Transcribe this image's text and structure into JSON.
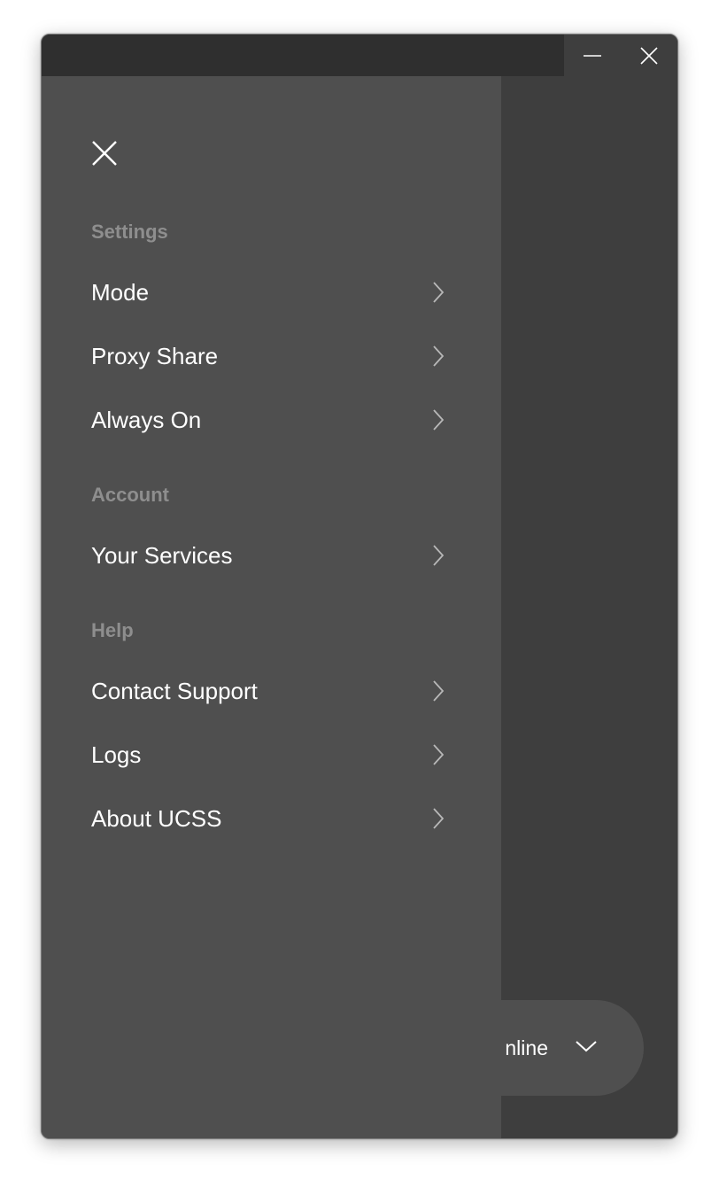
{
  "window": {
    "controls": {
      "minimize_icon": "minimize-icon",
      "close_icon": "close-icon"
    }
  },
  "drawer": {
    "close_icon": "close-icon",
    "sections": [
      {
        "header": "Settings",
        "items": [
          {
            "label": "Mode",
            "icon": "chevron-right-icon"
          },
          {
            "label": "Proxy Share",
            "icon": "chevron-right-icon"
          },
          {
            "label": "Always On",
            "icon": "chevron-right-icon"
          }
        ]
      },
      {
        "header": "Account",
        "items": [
          {
            "label": "Your Services",
            "icon": "chevron-right-icon"
          }
        ]
      },
      {
        "header": "Help",
        "items": [
          {
            "label": "Contact Support",
            "icon": "chevron-right-icon"
          },
          {
            "label": "Logs",
            "icon": "chevron-right-icon"
          },
          {
            "label": "About UCSS",
            "icon": "chevron-right-icon"
          }
        ]
      }
    ]
  },
  "status": {
    "visible_text": "nline",
    "icon": "chevron-down-icon"
  },
  "colors": {
    "titlebar": "#2f2f2f",
    "background": "#3e3e3e",
    "drawer": "#4f4f4f",
    "section_header": "#8e8e8e",
    "text": "#ffffff"
  }
}
